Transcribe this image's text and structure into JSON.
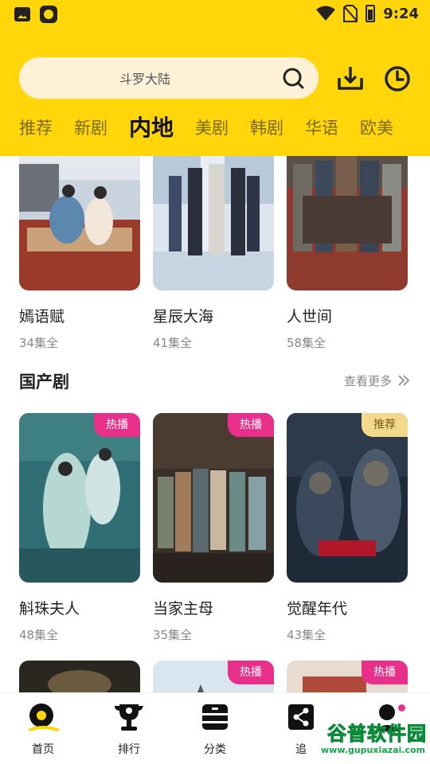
{
  "status_bar": {
    "time": "9:24"
  },
  "search": {
    "placeholder": "斗罗大陆"
  },
  "tabs": [
    {
      "label": "推荐"
    },
    {
      "label": "新剧"
    },
    {
      "label": "内地"
    },
    {
      "label": "美剧"
    },
    {
      "label": "韩剧"
    },
    {
      "label": "华语"
    },
    {
      "label": "欧美"
    }
  ],
  "active_tab": "内地",
  "row1": [
    {
      "title": "嫣语赋",
      "episodes": "34集全"
    },
    {
      "title": "星辰大海",
      "episodes": "41集全"
    },
    {
      "title": "人世间",
      "episodes": "58集全"
    }
  ],
  "section": {
    "title": "国产剧",
    "more": "查看更多"
  },
  "row2": [
    {
      "title": "斛珠夫人",
      "episodes": "48集全",
      "badge": "热播"
    },
    {
      "title": "当家主母",
      "episodes": "35集全",
      "badge": "热播"
    },
    {
      "title": "觉醒年代",
      "episodes": "43集全",
      "badge": "推荐"
    }
  ],
  "row3": [
    {
      "badge": ""
    },
    {
      "badge": "热播"
    },
    {
      "badge": "热播"
    }
  ],
  "nav": [
    {
      "label": "首页",
      "icon": "home-camera-icon"
    },
    {
      "label": "排行",
      "icon": "trophy-icon"
    },
    {
      "label": "分类",
      "icon": "category-icon"
    },
    {
      "label": "追",
      "icon": "share-icon"
    },
    {
      "label": "",
      "icon": "user-icon"
    }
  ],
  "watermark": {
    "name": "谷普软件园",
    "url": "www.gupuxiazai.com"
  },
  "colors": {
    "brand": "#FFD60A",
    "hot_badge": "#E8308A",
    "rec_badge": "#F5D98A"
  }
}
